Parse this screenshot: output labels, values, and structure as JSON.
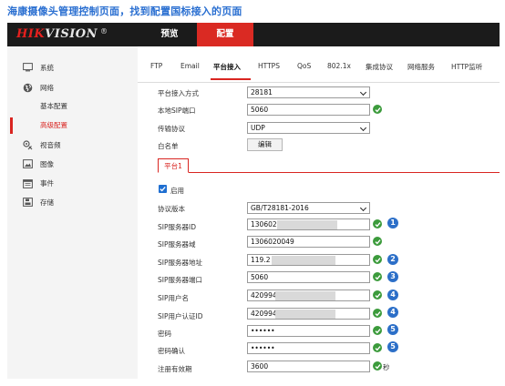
{
  "caption": "海康摄像头管理控制页面，找到配置国标接入的页面",
  "brand": {
    "logo_first": "HIK",
    "logo_rest": "VISION",
    "registered": "®"
  },
  "topnav": {
    "preview": "预览",
    "config": "配置"
  },
  "colors": {
    "accent": "#da2a23",
    "ok": "#3c9b3c",
    "badge": "#2c6fc8",
    "caption": "#2a6fd1",
    "topbar": "#1b1b1b"
  },
  "sidebar": {
    "items": [
      {
        "label": "系统",
        "icon": "monitor-icon"
      },
      {
        "label": "网络",
        "icon": "globe-icon"
      },
      {
        "label": "视音频",
        "icon": "camera-audio-icon"
      },
      {
        "label": "图像",
        "icon": "image-icon"
      },
      {
        "label": "事件",
        "icon": "calendar-icon"
      },
      {
        "label": "存储",
        "icon": "storage-icon"
      }
    ],
    "network_sub": [
      {
        "label": "基本配置",
        "active": false
      },
      {
        "label": "高级配置",
        "active": true
      }
    ]
  },
  "tabs": [
    "FTP",
    "Email",
    "平台接入",
    "HTTPS",
    "QoS",
    "802.1x",
    "集成协议",
    "网络服务",
    "HTTP监听"
  ],
  "active_tab": "平台接入",
  "form": {
    "access_mode_label": "平台接入方式",
    "access_mode_value": "28181",
    "local_sip_port_label": "本地SIP端口",
    "local_sip_port_value": "5060",
    "transport_label": "传输协议",
    "transport_value": "UDP",
    "whitelist_label": "白名单",
    "whitelist_button": "编辑"
  },
  "platform_tab": "平台1",
  "platform": {
    "enable_label": "启用",
    "enabled": true,
    "protocol_version_label": "协议版本",
    "protocol_version_value": "GB/T28181-2016",
    "sip_server_id_label": "SIP服务器ID",
    "sip_server_id_value": "130602",
    "sip_server_domain_label": "SIP服务器域",
    "sip_server_domain_value": "1306020049",
    "sip_server_addr_label": "SIP服务器地址",
    "sip_server_addr_value": "119.2",
    "sip_server_port_label": "SIP服务器端口",
    "sip_server_port_value": "5060",
    "sip_username_label": "SIP用户名",
    "sip_username_value": "420994",
    "sip_auth_id_label": "SIP用户认证ID",
    "sip_auth_id_value": "420994",
    "password_label": "密码",
    "password_value": "••••••",
    "password_confirm_label": "密码确认",
    "password_confirm_value": "••••••",
    "register_validity_label": "注册有效期",
    "register_validity_value": "3600",
    "register_validity_unit": "秒"
  },
  "badges": {
    "sip_server_id": "1",
    "sip_server_addr": "2",
    "sip_server_port": "3",
    "sip_username": "4",
    "sip_auth_id": "4",
    "password": "5",
    "password_confirm": "5"
  }
}
